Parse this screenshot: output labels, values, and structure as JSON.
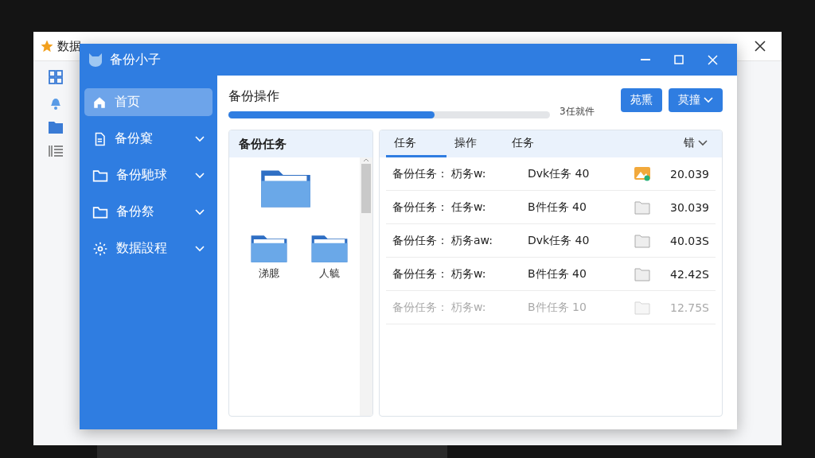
{
  "back_window": {
    "title": "数据"
  },
  "window": {
    "title": "备份小子"
  },
  "sidebar": {
    "items": [
      {
        "label": "首页",
        "kind": "home",
        "selected": true,
        "expandable": false
      },
      {
        "label": "备份窠",
        "kind": "document",
        "selected": false,
        "expandable": true
      },
      {
        "label": "备份馳球",
        "kind": "folder",
        "selected": false,
        "expandable": true
      },
      {
        "label": "备份祭",
        "kind": "folder",
        "selected": false,
        "expandable": true
      },
      {
        "label": "数据設程",
        "kind": "settings",
        "selected": false,
        "expandable": true
      }
    ]
  },
  "operation": {
    "title": "备份操作",
    "level": 0.64,
    "status": "3任就件",
    "buttons": [
      {
        "label": "苑熏",
        "dropdown": false
      },
      {
        "label": "莫撞",
        "dropdown": true
      }
    ]
  },
  "task_panel": {
    "title": "备份任务",
    "folders": [
      {
        "kind": "large"
      },
      {
        "kind": "small",
        "label": "涕臆"
      },
      {
        "kind": "small",
        "label": "人毓"
      }
    ]
  },
  "table": {
    "columns": [
      {
        "label": "任务",
        "selected": true
      },
      {
        "label": "操作",
        "selected": false
      },
      {
        "label": "任务",
        "selected": false
      },
      {
        "label": "错",
        "selected": false
      }
    ],
    "rows": [
      {
        "name": "备份任务：",
        "type": "杤务w:",
        "detail": "Dvk任务 40",
        "kind": "image",
        "size": "20.039",
        "disabled": false
      },
      {
        "name": "备份任务：",
        "type": "任务w:",
        "detail": "B件任务 40",
        "kind": "folder",
        "size": "30.039",
        "disabled": false
      },
      {
        "name": "备份任务：",
        "type": "杤务aw:",
        "detail": "Dvk任务 40",
        "kind": "folder",
        "size": "40.03S",
        "disabled": false
      },
      {
        "name": "备份任务：",
        "type": "杤务w:",
        "detail": "B件任务 40",
        "kind": "folder",
        "size": "42.42S",
        "disabled": false
      },
      {
        "name": "备份任务：",
        "type": "杤务w:",
        "detail": "B件任务 10",
        "kind": "folder",
        "size": "12.75S",
        "disabled": true
      }
    ]
  }
}
